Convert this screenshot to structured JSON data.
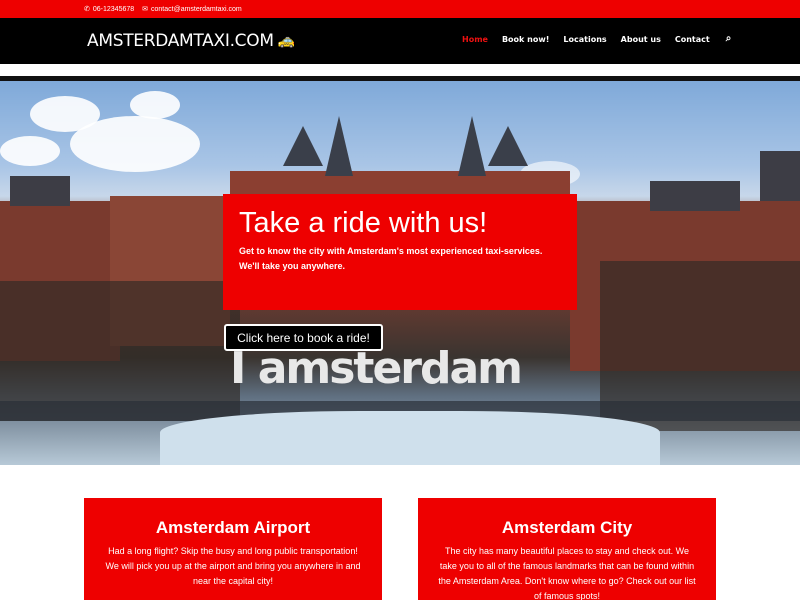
{
  "topbar": {
    "phone": "06-12345678",
    "email": "contact@amsterdamtaxi.com"
  },
  "header": {
    "logo": "AMSTERDAMTAXI.COM",
    "nav": [
      "Home",
      "Book now!",
      "Locations",
      "About us",
      "Contact"
    ],
    "active_index": 0
  },
  "hero": {
    "title": "Take a ride with us!",
    "text_line1": "Get to know the city with Amsterdam's most experienced taxi-services.",
    "text_line2": "We'll take you anywhere.",
    "cta": "Click here to book a ride!",
    "sign": "I amsterdam"
  },
  "cards": [
    {
      "title": "Amsterdam Airport",
      "text": "Had a long flight? Skip the busy and long public transportation! We will pick you up at the airport and bring you anywhere in and near the capital city!"
    },
    {
      "title": "Amsterdam City",
      "text": "The city has many beautiful places to stay and check out. We take you to all of the famous landmarks that can be found within the Amsterdam Area. Don't know where to go? Check out our list of famous spots!"
    }
  ],
  "colors": {
    "brand_red": "#ee0000",
    "header_black": "#000000"
  },
  "icons": [
    "phone-icon",
    "envelope-icon",
    "car-icon",
    "search-icon"
  ]
}
